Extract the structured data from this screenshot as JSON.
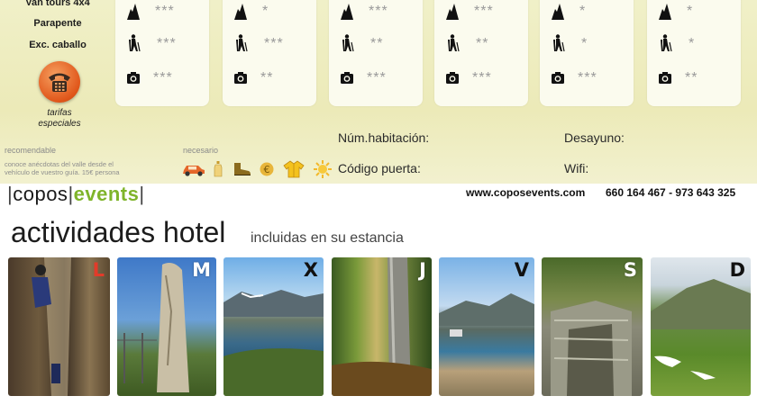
{
  "left": {
    "labels": [
      "Van tours 4x4",
      "Parapente",
      "Exc. caballo"
    ],
    "tarifas": [
      "tarifas",
      "especiales"
    ],
    "recomendable": "recomendable",
    "recomendable_text": [
      "conoce anécdotas del valle desde el",
      "vehículo de vuestro guía. 15€ persona"
    ],
    "necesario": "necesario",
    "necesario_icons": [
      "car-icon",
      "bottle-icon",
      "boots-icon",
      "euro-icon",
      "jacket-icon",
      "sun-icon"
    ]
  },
  "cards": [
    {
      "mountain": "***",
      "hiker": "***",
      "camera": "***"
    },
    {
      "mountain": "*",
      "hiker": "***",
      "camera": "**"
    },
    {
      "mountain": "***",
      "hiker": "**",
      "camera": "***"
    },
    {
      "mountain": "***",
      "hiker": "**",
      "camera": "***"
    },
    {
      "mountain": "*",
      "hiker": "*",
      "camera": "***"
    },
    {
      "mountain": "*",
      "hiker": "*",
      "camera": "**"
    }
  ],
  "fields": {
    "habitacion": "Núm.habitación:",
    "puerta": "Código puerta:",
    "desayuno": "Desayuno:",
    "wifi": "Wifi:"
  },
  "brand": {
    "bar1": "|",
    "copos": "copos",
    "bar2": "|",
    "events": "events",
    "bar3": "|"
  },
  "contact": {
    "url": "www.coposevents.com",
    "phones": "660 164 467 - 973 643 325"
  },
  "headline": "actividades hotel",
  "subheadline": "incluidas en su estancia",
  "days": [
    {
      "letter": "L",
      "color": "#e23b2a"
    },
    {
      "letter": "M",
      "color": "#ffffff"
    },
    {
      "letter": "X",
      "color": "#111111"
    },
    {
      "letter": "J",
      "color": "#ffffff"
    },
    {
      "letter": "V",
      "color": "#111111"
    },
    {
      "letter": "S",
      "color": "#ffffff"
    },
    {
      "letter": "D",
      "color": "#111111"
    }
  ]
}
